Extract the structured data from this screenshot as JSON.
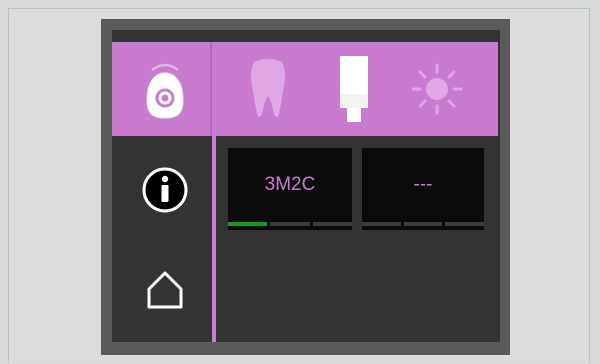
{
  "tiles": [
    {
      "label": "3M2C",
      "bars": [
        true,
        false,
        false
      ]
    },
    {
      "label": "---",
      "bars": [
        false,
        false,
        false
      ]
    }
  ],
  "icons": {
    "device": "curing-light-device-icon",
    "info": "info-icon",
    "home": "home-icon",
    "tooth": "tooth-icon",
    "shade_tab": "shade-tab-icon",
    "light": "sun-light-icon"
  },
  "colors": {
    "accent": "#c97bd0",
    "screen_background": "#333333",
    "tile_background": "#0b0b0b",
    "active_bar": "#179a23",
    "inactive_bar": "#3c3c3c",
    "bezel": "#5a5a5a",
    "page_background": "#d9d9d9"
  }
}
